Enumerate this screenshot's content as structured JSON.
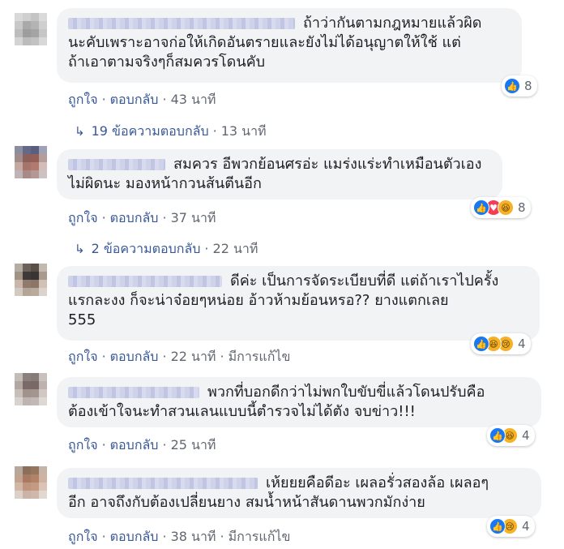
{
  "comments": [
    {
      "lines": [
        "ถ้าว่ากันตามกฎหมายแล้วผิด",
        "นะคับเพราะอาจก่อให้เกิดอันตรายและยังไม่ได้อนุญาตให้ใช้ แต่",
        "ถ้าเอาตามจริงๆก็สมควรโดนคับ"
      ],
      "like": "ถูกใจ",
      "reply": "ตอบกลับ",
      "time": "43 นาที",
      "edited": "",
      "reaction_count": "8",
      "reactions": [
        "like"
      ]
    },
    {
      "lines": [
        "สมควร อีพวกย้อนศรอ่ะ แมร่งแร่ะทำเหมือนตัวเอง",
        "ไม่ผิดนะ มองหน้ากวนส้นตีนอีก"
      ],
      "like": "ถูกใจ",
      "reply": "ตอบกลับ",
      "time": "37 นาที",
      "edited": "",
      "reaction_count": "8",
      "reactions": [
        "like",
        "love",
        "haha"
      ]
    },
    {
      "lines": [
        "ดีค่ะ เป็นการจัดระเบียบที่ดี แต่ถ้าเราไปครั้ง",
        "แรกละงง ก็จะน่าจ๋อยๆหน่อย อ้าวห้ามย้อนหรอ?? ยางแตกเลย",
        "555"
      ],
      "like": "ถูกใจ",
      "reply": "ตอบกลับ",
      "time": "22 นาที",
      "edited": "มีการแก้ไข",
      "reaction_count": "4",
      "reactions": [
        "like",
        "haha",
        "sad"
      ]
    },
    {
      "lines": [
        "พวกที่บอกดีกว่าไม่พกใบขับขี่แล้วโดนปรับคือ",
        "ต้องเข้าใจนะทำสวนเลนแบบนี้ตำรวจไม่ได้ตัง จบข่าว!!!"
      ],
      "like": "ถูกใจ",
      "reply": "ตอบกลับ",
      "time": "25 นาที",
      "edited": "",
      "reaction_count": "4",
      "reactions": [
        "like",
        "haha"
      ]
    },
    {
      "lines": [
        "เห้ยยยคือดีอะ เผลอรั่วสองล้อ เผลอๆ",
        "อีก อาจถึงกับต้องเปลี่ยนยาง สมน้ำหน้าสันดานพวกมักง่าย"
      ],
      "like": "ถูกใจ",
      "reply": "ตอบกลับ",
      "time": "38 นาที",
      "edited": "มีการแก้ไข",
      "reaction_count": "4",
      "reactions": [
        "like",
        "sad"
      ]
    }
  ],
  "reply_threads": [
    {
      "text": "19 ข้อความตอบกลับ",
      "time": "13 นาที"
    },
    {
      "text": "2 ข้อความตอบกลับ",
      "time": "22 นาที"
    }
  ],
  "icons": {
    "like": "thumbs-up-icon",
    "love": "heart-icon",
    "haha": "laugh-emoji-icon",
    "sad": "sad-emoji-icon",
    "reply_arrow": "reply-arrow-icon"
  },
  "colors": {
    "link": "#385898",
    "meta": "#606770",
    "bubble": "#f2f3f5",
    "like": "#1877f2",
    "love": "#f33e58",
    "emoji": "#f7b125"
  }
}
